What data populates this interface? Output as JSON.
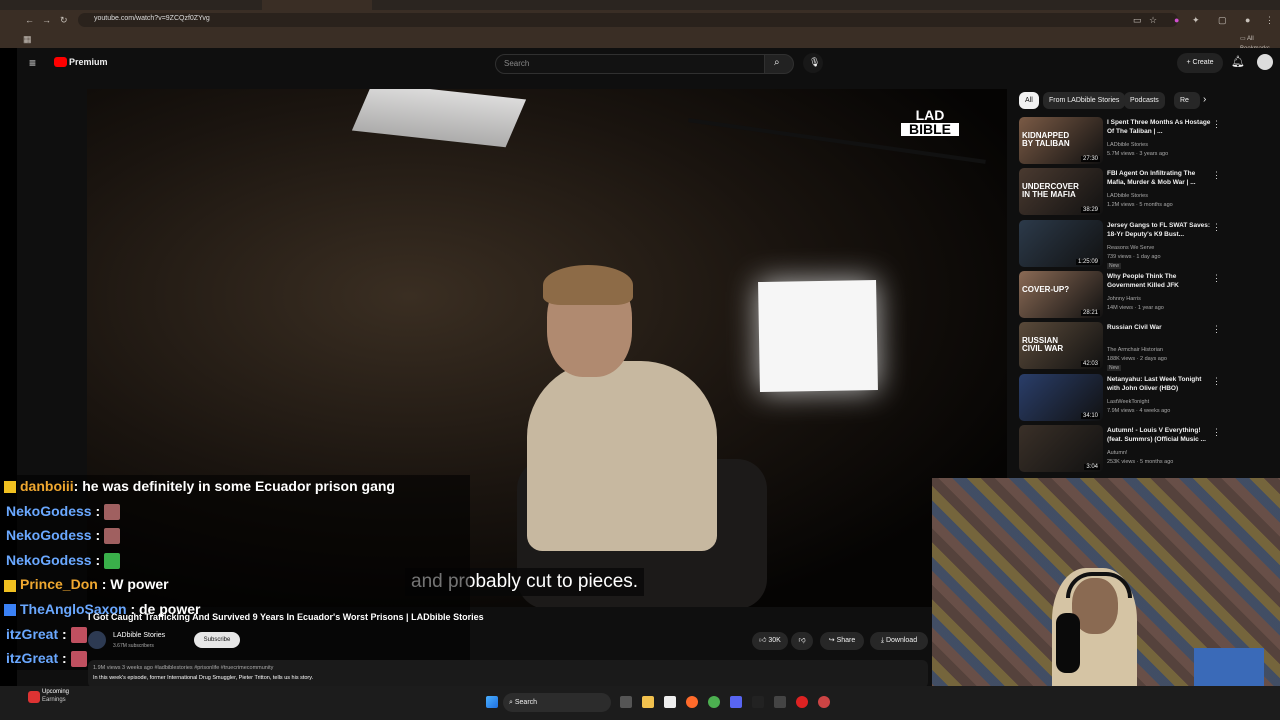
{
  "browser": {
    "url": "youtube.com/watch?v=9ZCQzf0ZYvg",
    "bookmarks_label": "All Bookmarks",
    "tabs": [
      "",
      "",
      "",
      ""
    ]
  },
  "youtube": {
    "logo_text": "Premium",
    "search_placeholder": "Search",
    "create_label": "Create"
  },
  "video": {
    "subtitle": "and probably cut to pieces.",
    "watermark_line1": "LAD",
    "watermark_line2": "BIBLE",
    "title": "I Got Caught Trafficking And Survived 9 Years In Ecuador's Worst Prisons | LADbible Stories",
    "channel": "LADbible Stories",
    "subscribers": "3.67M subscribers",
    "subscribe_label": "Subscribe",
    "like_count": "30K",
    "share_label": "Share",
    "download_label": "Download",
    "desc_meta": "1.9M views  3 weeks ago  #ladbiblestories #prisonlife #truecrimecommunity",
    "desc_text": "In this week's episode, former International Drug Smuggler, Pieter Tritton, tells us his story."
  },
  "chips": [
    "All",
    "From LADbible Stories",
    "Podcasts",
    "Re"
  ],
  "recommendations": [
    {
      "title": "I Spent Three Months As Hostage Of The Taliban | ...",
      "channel": "LADbible Stories",
      "meta": "5.7M views · 3 years ago",
      "duration": "27:30",
      "new": "",
      "thumb_text": "KIDNAPPED BY TALIBAN",
      "thumb_color": "#7a5a45"
    },
    {
      "title": "FBI Agent On Infiltrating The Mafia, Murder & Mob War | ...",
      "channel": "LADbible Stories",
      "meta": "1.2M views · 5 months ago",
      "duration": "38:29",
      "new": "",
      "thumb_text": "UNDERCOVER IN THE MAFIA",
      "thumb_color": "#4a3a30"
    },
    {
      "title": "Jersey Gangs to FL SWAT Saves: 18-Yr Deputy's K9 Bust...",
      "channel": "Reasons We Serve",
      "meta": "739 views · 1 day ago",
      "duration": "1:25:09",
      "new": "New",
      "thumb_text": "",
      "thumb_color": "#2c3a4a"
    },
    {
      "title": "Why People Think The Government Killed JFK",
      "channel": "Johnny Harris",
      "meta": "14M views · 1 year ago",
      "duration": "28:21",
      "new": "",
      "thumb_text": "COVER-UP?",
      "thumb_color": "#8a6a55"
    },
    {
      "title": "Russian Civil War",
      "channel": "The Armchair Historian",
      "meta": "188K views · 2 days ago",
      "duration": "42:03",
      "new": "New",
      "thumb_text": "RUSSIAN CIVIL WAR",
      "thumb_color": "#5a4a3a"
    },
    {
      "title": "Netanyahu: Last Week Tonight with John Oliver (HBO)",
      "channel": "LastWeekTonight",
      "meta": "7.9M views · 4 weeks ago",
      "duration": "34:10",
      "new": "",
      "thumb_text": "",
      "thumb_color": "#2a3e6a"
    },
    {
      "title": "Autumn! - Louis V Everything! (feat. Summrs) (Official Music ...",
      "channel": "Autumn!",
      "meta": "253K views · 5 months ago",
      "duration": "3:04",
      "new": "",
      "thumb_text": "",
      "thumb_color": "#3a3028"
    }
  ],
  "chat": [
    {
      "user": "danboiii",
      "message": ": he was definitely in some Ecuador prison gang",
      "color": "#f0a830"
    },
    {
      "user": "NekoGodess",
      "message": " :",
      "color": "#6aa8ff"
    },
    {
      "user": "NekoGodess",
      "message": " :",
      "color": "#6aa8ff"
    },
    {
      "user": "NekoGodess",
      "message": " :",
      "color": "#6aa8ff"
    },
    {
      "user": "Prince_Don",
      "message": " : W power",
      "color": "#f0a830"
    },
    {
      "user": "TheAngloSaxon",
      "message": " : de power",
      "color": "#6aa8ff"
    },
    {
      "user": "itzGreat",
      "message": " :",
      "color": "#6aa8ff"
    },
    {
      "user": "itzGreat",
      "message": " :",
      "color": "#6aa8ff"
    }
  ],
  "taskbar": {
    "weather_title": "Upcoming",
    "weather_sub": "Earnings",
    "search_label": "Search"
  }
}
